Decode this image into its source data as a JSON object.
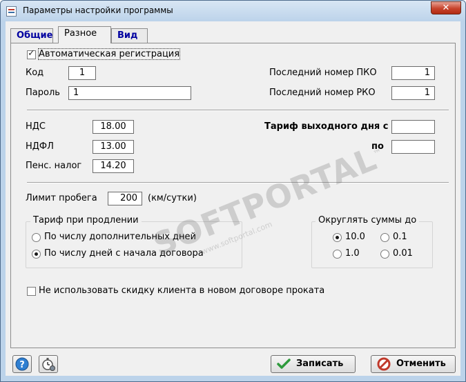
{
  "window": {
    "title": "Параметры настройки программы",
    "close_glyph": "✕"
  },
  "tabs": [
    {
      "label": "Общие",
      "active": false
    },
    {
      "label": "Разное",
      "active": true
    },
    {
      "label": "Вид",
      "active": false
    }
  ],
  "misc": {
    "auto_registration": {
      "label": "Автоматическая регистрация",
      "checked": true
    },
    "code": {
      "label": "Код",
      "value": "1"
    },
    "password": {
      "label": "Пароль",
      "value": "1"
    },
    "last_pko": {
      "label": "Последний номер ПКО",
      "value": "1"
    },
    "last_rko": {
      "label": "Последний номер РКО",
      "value": "1"
    },
    "vat": {
      "label": "НДС",
      "value": "18.00"
    },
    "ndfl": {
      "label": "НДФЛ",
      "value": "13.00"
    },
    "pension_tax": {
      "label": "Пенс. налог",
      "value": "14.20"
    },
    "weekend_rate_from": {
      "label": "Тариф выходного дня с",
      "value": ""
    },
    "weekend_rate_to": {
      "label": "по",
      "value": ""
    },
    "mileage_limit": {
      "label": "Лимит пробега",
      "value": "200",
      "unit": "(км/сутки)"
    },
    "extension_rate": {
      "title": "Тариф при продлении",
      "options": [
        {
          "label": "По числу дополнительных дней",
          "selected": false
        },
        {
          "label": "По числу дней с начала договора",
          "selected": true
        }
      ]
    },
    "rounding": {
      "title": "Округлять суммы до",
      "options": [
        {
          "label": "10.0",
          "selected": true
        },
        {
          "label": "0.1",
          "selected": false
        },
        {
          "label": "1.0",
          "selected": false
        },
        {
          "label": "0.01",
          "selected": false
        }
      ]
    },
    "no_client_discount": {
      "label": "Не использовать скидку клиента в новом договоре проката",
      "checked": false
    }
  },
  "watermark": {
    "brand": "SOFTPORTAL",
    "url": "www.softportal.com",
    "tm": "™"
  },
  "footer": {
    "help_icon": "help-icon",
    "settings_icon": "stopwatch-settings-icon",
    "save_label": "Записать",
    "cancel_label": "Отменить"
  },
  "colors": {
    "tab_inactive_text": "#0000a0",
    "close_button": "#c7432c",
    "save_check": "#2e9a3c",
    "cancel_icon": "#c0392b"
  }
}
